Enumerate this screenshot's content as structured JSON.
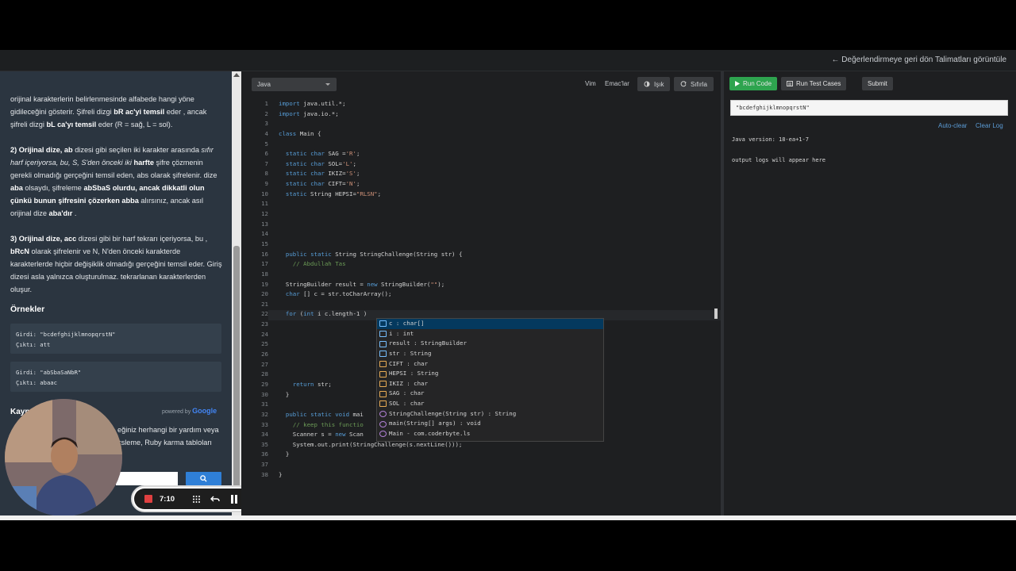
{
  "header": {
    "back_link": "← Değerlendirmeye geri dön Talimatları görüntüle"
  },
  "instructions": {
    "p1_a": "orijinal karakterlerin belirlenmesinde alfabede hangi yöne gidileceğini gösterir. Şifreli dizgi ",
    "p1_b": "bR ac'yi temsil",
    "p1_c": " eder , ancak şifreli dizgi ",
    "p1_d": "bL ca'yı temsil",
    "p1_e": " eder (R = sağ, L = sol).",
    "p2_a": "2) Orijinal dize, ",
    "p2_b": "ab",
    "p2_c": " dizesi gibi seçilen iki karakter arasında ",
    "p2_d": "sıfır harf içeriyorsa, bu, S, S'den önceki iki ",
    "p2_e": "harfte",
    "p2_f": " şifre çözmenin gerekli olmadığı gerçeğini temsil eden, abs olarak şifrelenir. dize ",
    "p2_g": "aba",
    "p2_h": " olsaydı, şifreleme ",
    "p2_i": "abSbaS olurdu, ancak dikkatli olun çünkü bunun şifresini çözerken abba",
    "p2_j": " alırsınız, ancak asıl orijinal dize ",
    "p2_k": "aba'dır",
    "p2_l": " .",
    "p3_a": "3) Orijinal dize, acc",
    "p3_b": " dizesi gibi bir harf tekrarı içeriyorsa, bu , ",
    "p3_c": "bRcN",
    "p3_d": " olarak şifrelenir ve N, N'den önceki karakterde karakterlerde hiçbir değişiklik olmadığı gerçeğini temsil eder. Giriş dizesi asla yalnızca oluşturulmaz. tekrarlanan karakterlerden oluşur.",
    "examples_title": "Örnekler",
    "example1_input": "Girdi: \"bcdefghijklmnopqrstN\"",
    "example1_output": "Çıktı: att",
    "example2_input": "Girdi: \"abSbaSaNbR\"",
    "example2_output": "Çıktı: abaac",
    "powered_by": "powered by",
    "google": "Google",
    "resources_title": "Kayn",
    "resources_line1": "eğiniz herhangi bir yardım veya",
    "resources_line2": "ksleme, Ruby karma tabloları"
  },
  "recorder": {
    "time": "7:10"
  },
  "editor": {
    "language": "Java",
    "vim": "Vim",
    "emacs": "Emac'lar",
    "light": "Işık",
    "reset": "Sıfırla",
    "line_numbers": [
      "1",
      "2",
      "3",
      "4",
      "5",
      "6",
      "7",
      "8",
      "9",
      "10",
      "11",
      "12",
      "13",
      "14",
      "15",
      "16",
      "17",
      "18",
      "19",
      "20",
      "21",
      "22",
      "23",
      "24",
      "25",
      "26",
      "27",
      "28",
      "29",
      "30",
      "31",
      "32",
      "33",
      "34",
      "35",
      "36",
      "37",
      "38"
    ]
  },
  "autocomplete": {
    "items": [
      "c : char[]",
      "i : int",
      "result : StringBuilder",
      "str : String",
      "CIFT : char",
      "HEPSI : String",
      "IKIZ : char",
      "SAG : char",
      "SOL : char",
      "StringChallenge(String str) : String",
      "main(String[] args) : void",
      "Main - com.coderbyte.ls"
    ]
  },
  "right_panel": {
    "run_code": "Run Code",
    "run_tests": "Run Test Cases",
    "submit": "Submit",
    "input_value": "\"bcdefghijklmnopqrstN\"",
    "auto_clear": "Auto-clear",
    "clear_log": "Clear Log",
    "java_version": "Java version: 18-ea+1-7",
    "output_placeholder": "output logs will appear here"
  },
  "colors": {
    "run_code_green": "#2ea44f",
    "accent_blue": "#5b9bd5"
  }
}
